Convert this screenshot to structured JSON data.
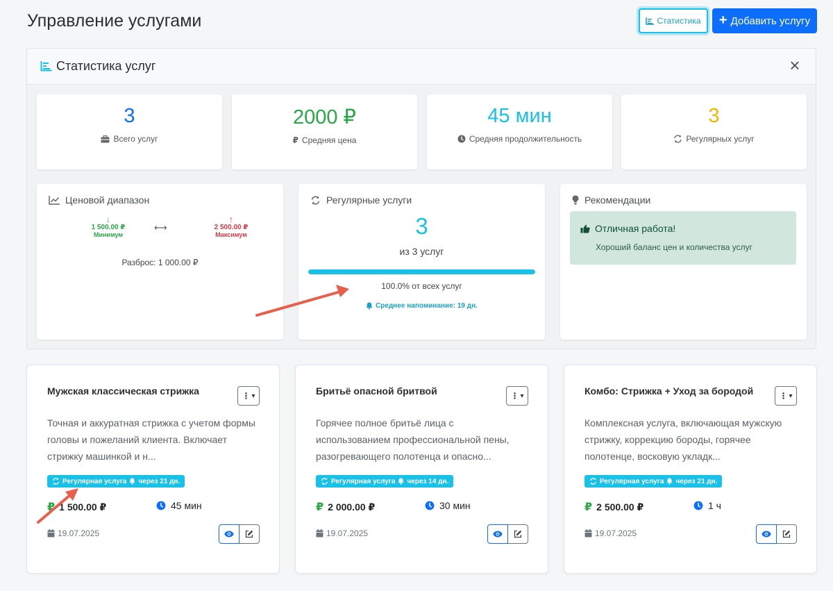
{
  "header": {
    "title": "Управление услугами",
    "stats_button": "Статистика",
    "add_button": "Добавить услугу"
  },
  "stats": {
    "title": "Статистика услуг",
    "close_icon": "×",
    "cards": [
      {
        "value": "3",
        "label": "Всего услуг",
        "icon": "briefcase-icon",
        "color": "#0d6efd"
      },
      {
        "value": "2000 ₽",
        "label": "Средняя цена",
        "icon": "ruble-icon",
        "color": "#28a745"
      },
      {
        "value": "45 мин",
        "label": "Средняя продолжительность",
        "icon": "clock-icon",
        "color": "#17c1e8"
      },
      {
        "value": "3",
        "label": "Регулярных услуг",
        "icon": "repeat-icon",
        "color": "#f5b400"
      }
    ],
    "price_range": {
      "title": "Ценовой диапазон",
      "min_value": "1 500.00 ₽",
      "min_label": "Минимум",
      "max_value": "2 500.00 ₽",
      "max_label": "Максимум",
      "spread": "Разброс: 1 000.00 ₽"
    },
    "regular": {
      "title": "Регулярные услуги",
      "count": "3",
      "of_text": "из 3 услуг",
      "percent_value": 100,
      "percent_text": "100.0% от всех услуг",
      "reminder": "Среднее напоминание: 19 дн."
    },
    "recommendations": {
      "title": "Рекомендации",
      "heading": "Отличная работа!",
      "text": "Хороший баланс цен и количества услуг"
    }
  },
  "services": [
    {
      "name": "Мужская классическая стрижка",
      "description": "Точная и аккуратная стрижка с учетом формы головы и пожеланий клиента. Включает стрижку машинкой и н...",
      "badge": "Регулярная услуга",
      "badge_remind": "через 21 дн.",
      "price": "1 500.00 ₽",
      "duration": "45 мин",
      "date": "19.07.2025"
    },
    {
      "name": "Бритьё опасной бритвой",
      "description": "Горячее полное бритьё лица с использованием профессиональной пены, разогревающего полотенца и опасно...",
      "badge": "Регулярная услуга",
      "badge_remind": "через 14 дн.",
      "price": "2 000.00 ₽",
      "duration": "30 мин",
      "date": "19.07.2025"
    },
    {
      "name": "Комбо: Стрижка + Уход за бородой",
      "description": "Комплексная услуга, включающая мужскую стрижку, коррекцию бороды, горячее полотенце, восковую укладк...",
      "badge": "Регулярная услуга",
      "badge_remind": "через 21 дн.",
      "price": "2 500.00 ₽",
      "duration": "1 ч",
      "date": "19.07.2025"
    }
  ],
  "colors": {
    "primary": "#0d6efd",
    "info": "#17c1e8",
    "success": "#28a745",
    "danger": "#dc3545",
    "warning": "#f5b400",
    "annotation": "#e8604c"
  }
}
